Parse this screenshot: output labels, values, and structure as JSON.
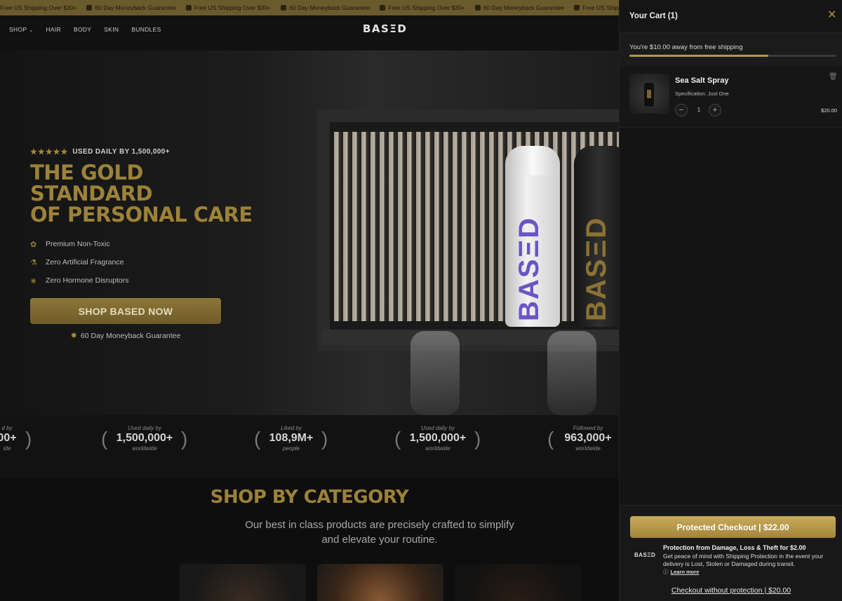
{
  "ticker": {
    "items": [
      {
        "icon": "truck-icon",
        "text": "Free US Shipping Over $30+"
      },
      {
        "icon": "shield-icon",
        "text": "60 Day Moneyback Guarantee"
      },
      {
        "icon": "truck-icon",
        "text": "Free US Shipping Over $30+"
      },
      {
        "icon": "shield-icon",
        "text": "60 Day Moneyback Guarantee"
      },
      {
        "icon": "truck-icon",
        "text": "Free US Shipping Over $30+"
      },
      {
        "icon": "shield-icon",
        "text": "60 Day Moneyback Guarantee"
      },
      {
        "icon": "truck-icon",
        "text": "Free US Shipping Over $30+"
      }
    ]
  },
  "nav": {
    "links": [
      "SHOP",
      "HAIR",
      "BODY",
      "SKIN",
      "BUNDLES"
    ],
    "logo": "BASΞD"
  },
  "hero": {
    "stars": "★★★★★",
    "rating_text": "USED DAILY BY 1,500,000+",
    "headline_line1": "THE GOLD STANDARD",
    "headline_line2": "OF PERSONAL CARE",
    "features": [
      {
        "icon": "leaf-icon",
        "text": "Premium Non-Toxic"
      },
      {
        "icon": "flask-icon",
        "text": "Zero Artificial Fragrance"
      },
      {
        "icon": "dna-icon",
        "text": "Zero Hormone Disruptors"
      }
    ],
    "cta_label": "SHOP BASED NOW",
    "guarantee": "60 Day Moneyback Guarantee",
    "bottle_white_brand": "BASΞD",
    "bottle_black_brand": "BASΞD"
  },
  "stats": [
    {
      "label": "d by",
      "value": "00+",
      "sub": "ide"
    },
    {
      "label": "Used daily by",
      "value": "1,500,000+",
      "sub": "worldwide"
    },
    {
      "label": "Liked by",
      "value": "108,9M+",
      "sub": "people"
    },
    {
      "label": "Used daily by",
      "value": "1,500,000+",
      "sub": "worldwide"
    },
    {
      "label": "Followed by",
      "value": "963,000+",
      "sub": "worldwide"
    }
  ],
  "category": {
    "title": "SHOP BY CATEGORY",
    "subtitle": "Our best in class products are precisely crafted to simplify and elevate your routine."
  },
  "cart": {
    "title": "Your Cart (1)",
    "shipping_message": "You're $10.00 away from free shipping",
    "shipping_progress": 0.67,
    "items": [
      {
        "name": "Sea Salt Spray",
        "spec": "Specification: Just One",
        "quantity": "1",
        "price": "$20.00"
      }
    ],
    "checkout_label": "Protected Checkout | $22.00",
    "protection_logo": "BASΞD",
    "protection_title": "Protection from Damage, Loss & Theft for $2.00",
    "protection_desc": "Get peace of mind with Shipping Protection in the event your delivery is Lost, Stolen or Damaged during transit.",
    "learn_more": "Learn more",
    "no_protection_label": "Checkout without protection | $20.00"
  },
  "colors": {
    "gold": "#9c8139",
    "gold_button": "#b59642",
    "background": "#111111"
  }
}
